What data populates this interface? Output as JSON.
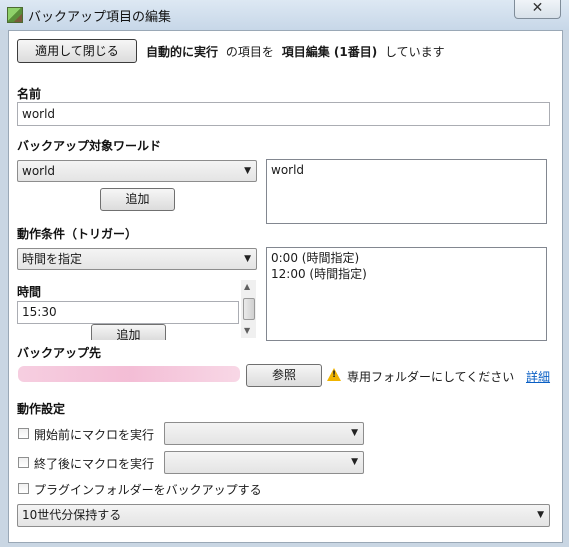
{
  "window": {
    "title": "バックアップ項目の編集",
    "close_glyph": "✕"
  },
  "header": {
    "apply_button": "適用して閉じる",
    "mode_label": "自動的に実行",
    "text1": "の項目を",
    "edit_label": "項目編集 (1番目)",
    "text2": "しています"
  },
  "name": {
    "label": "名前",
    "value": "world"
  },
  "target_world": {
    "label": "バックアップ対象ワールド",
    "select_value": "world",
    "add_button": "追加",
    "list": [
      "world"
    ]
  },
  "trigger": {
    "label": "動作条件（トリガー）",
    "select_value": "時間を指定",
    "time_label": "時間",
    "time_value": "15:30",
    "add_button": "追加",
    "list": [
      "0:00 (時間指定)",
      "12:00 (時間指定)"
    ]
  },
  "destination": {
    "label": "バックアップ先",
    "browse_button": "参照",
    "warning": "専用フォルダーにしてください",
    "details_link": "詳細"
  },
  "behavior": {
    "label": "動作設定",
    "pre_macro_label": "開始前にマクロを実行",
    "post_macro_label": "終了後にマクロを実行",
    "plugin_label": "プラグインフォルダーをバックアップする",
    "generations_value": "10世代分保持する"
  },
  "icons": {
    "dropdown": "▼",
    "scroll_up": "▲",
    "scroll_down": "▼",
    "warning_mark": "!"
  },
  "colors": {
    "link": "#0a5fc4",
    "warning": "#f0b400",
    "redaction": "#f2b6d1"
  }
}
